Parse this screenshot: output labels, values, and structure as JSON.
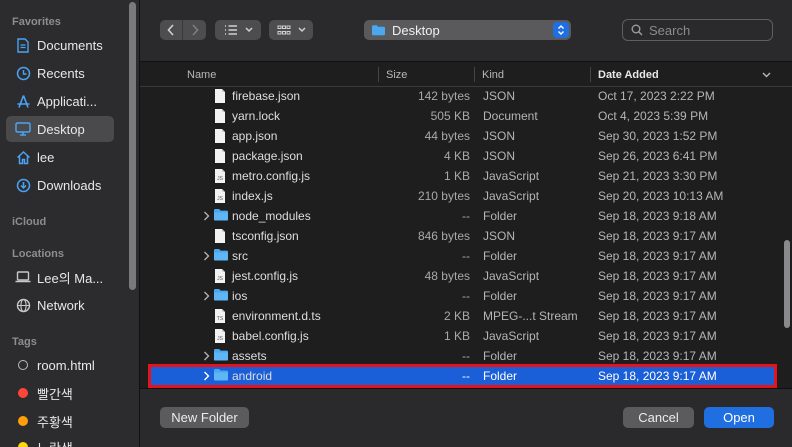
{
  "sidebar": {
    "favorites_heading": "Favorites",
    "favorites": [
      {
        "label": "Documents",
        "icon": "document-icon"
      },
      {
        "label": "Recents",
        "icon": "clock-icon"
      },
      {
        "label": "Applicati...",
        "icon": "applications-icon"
      },
      {
        "label": "Desktop",
        "icon": "desktop-icon",
        "selected": true
      },
      {
        "label": "lee",
        "icon": "home-icon"
      },
      {
        "label": "Downloads",
        "icon": "download-icon"
      }
    ],
    "icloud_heading": "iCloud",
    "locations_heading": "Locations",
    "locations": [
      {
        "label": "Lee의 Ma...",
        "icon": "laptop-icon"
      },
      {
        "label": "Network",
        "icon": "network-icon"
      }
    ],
    "tags_heading": "Tags",
    "tags": [
      {
        "label": "room.html",
        "color": "#00000000"
      },
      {
        "label": "빨간색",
        "color": "#ff453a"
      },
      {
        "label": "주황색",
        "color": "#ff9f0a"
      },
      {
        "label": "노란색",
        "color": "#ffd60a"
      }
    ]
  },
  "toolbar": {
    "path": "Desktop",
    "search_placeholder": "Search"
  },
  "columns": {
    "name": "Name",
    "size": "Size",
    "kind": "Kind",
    "date": "Date Added"
  },
  "files": [
    {
      "name": "firebase.json",
      "size": "142 bytes",
      "kind": "JSON",
      "date": "Oct 17, 2023 2:22 PM",
      "type": "file"
    },
    {
      "name": "yarn.lock",
      "size": "505 KB",
      "kind": "Document",
      "date": "Oct 4, 2023 5:39 PM",
      "type": "file"
    },
    {
      "name": "app.json",
      "size": "44 bytes",
      "kind": "JSON",
      "date": "Sep 30, 2023 1:52 PM",
      "type": "file"
    },
    {
      "name": "package.json",
      "size": "4 KB",
      "kind": "JSON",
      "date": "Sep 26, 2023 6:41 PM",
      "type": "file"
    },
    {
      "name": "metro.config.js",
      "size": "1 KB",
      "kind": "JavaScript",
      "date": "Sep 21, 2023 3:30 PM",
      "type": "js"
    },
    {
      "name": "index.js",
      "size": "210 bytes",
      "kind": "JavaScript",
      "date": "Sep 20, 2023 10:13 AM",
      "type": "js"
    },
    {
      "name": "node_modules",
      "size": "--",
      "kind": "Folder",
      "date": "Sep 18, 2023 9:18 AM",
      "type": "folder"
    },
    {
      "name": "tsconfig.json",
      "size": "846 bytes",
      "kind": "JSON",
      "date": "Sep 18, 2023 9:17 AM",
      "type": "file"
    },
    {
      "name": "src",
      "size": "--",
      "kind": "Folder",
      "date": "Sep 18, 2023 9:17 AM",
      "type": "folder"
    },
    {
      "name": "jest.config.js",
      "size": "48 bytes",
      "kind": "JavaScript",
      "date": "Sep 18, 2023 9:17 AM",
      "type": "js"
    },
    {
      "name": "ios",
      "size": "--",
      "kind": "Folder",
      "date": "Sep 18, 2023 9:17 AM",
      "type": "folder"
    },
    {
      "name": "environment.d.ts",
      "size": "2 KB",
      "kind": "MPEG-...t Stream",
      "date": "Sep 18, 2023 9:17 AM",
      "type": "ts"
    },
    {
      "name": "babel.config.js",
      "size": "1 KB",
      "kind": "JavaScript",
      "date": "Sep 18, 2023 9:17 AM",
      "type": "js"
    },
    {
      "name": "assets",
      "size": "--",
      "kind": "Folder",
      "date": "Sep 18, 2023 9:17 AM",
      "type": "folder"
    },
    {
      "name": "android",
      "size": "--",
      "kind": "Folder",
      "date": "Sep 18, 2023 9:17 AM",
      "type": "folder",
      "selected": true
    }
  ],
  "footer": {
    "new_folder": "New Folder",
    "cancel": "Cancel",
    "open": "Open"
  },
  "colors": {
    "accent": "#1f6fe0",
    "selection": "#1a5ed8",
    "highlight_outline": "#e8131a",
    "folder": "#4aa8f0"
  }
}
